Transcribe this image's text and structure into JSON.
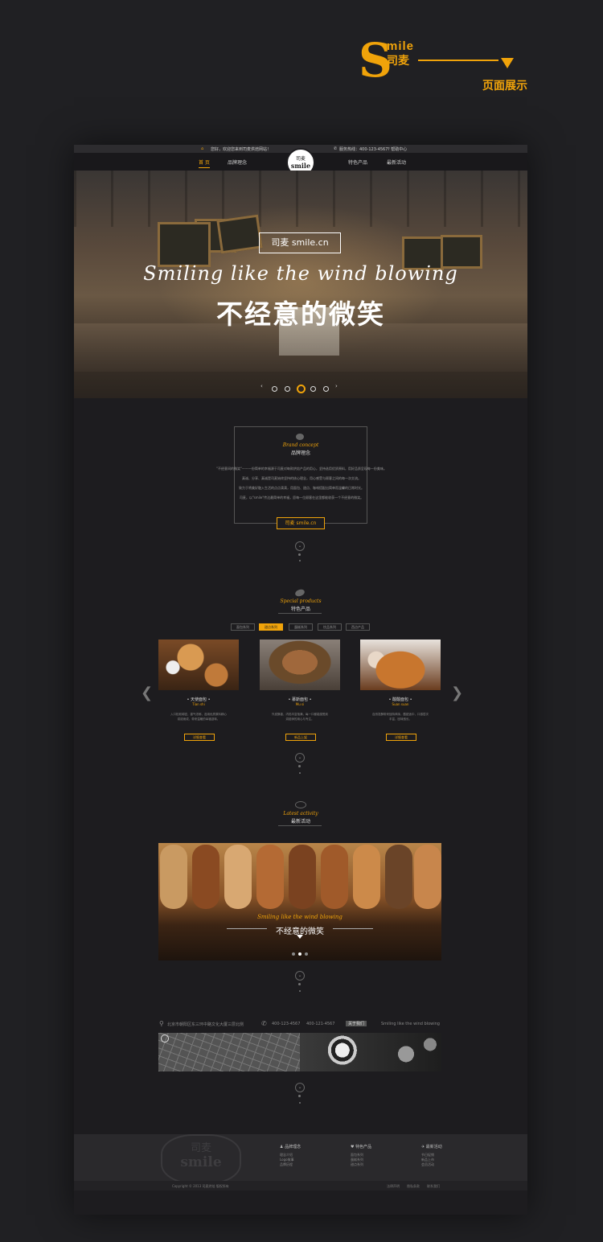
{
  "brand": {
    "s": "S",
    "mile": "mile",
    "cn": "司麦",
    "caption": "页面展示"
  },
  "topbar": {
    "welcome": "您好，欢迎您来到司麦烘焙网站！",
    "hotline": "服务热线：400-123-4567",
    "help": "帮助中心"
  },
  "nav": {
    "items": [
      "首 页",
      "品牌理念",
      "特色产品",
      "最新活动"
    ],
    "logo_cn": "司麦",
    "logo_en": "smile"
  },
  "hero": {
    "box_text": "司麦  smile.cn",
    "script": "Smiling like the wind blowing",
    "title": "不经意的微笑"
  },
  "concept": {
    "title_en": "Brand concept",
    "title_cn": "品牌理念",
    "paragraphs": [
      "\"不经意间的微笑\"——一份简单的幸福源于司麦对每款烘焙产品的用心，坚持选用优质原料，用好品质呈现每一份美味。",
      "真诚、分享、真诚是司麦始终坚持的核心理念，用心感受与顾客之间的每一次交流。",
      "致力于将美好融入生活的点点滴滴，用面包、甜点、咖啡搭配出简单而温馨的日常时光。",
      "司麦，以\"smile\"传达最简单的幸福，愿每一位顾客在这里都能收获一个不经意的微笑。"
    ],
    "button": "司麦  smile.cn"
  },
  "products": {
    "title_en": "Special products",
    "title_cn": "特色产品",
    "tabs": [
      "面包系列",
      "甜点系列",
      "蛋糕系列",
      "饮品系列",
      "西点产品"
    ],
    "items": [
      {
        "name": "• 天使面包 •",
        "en": "Tian shi",
        "desc": "入口松软绵密，香气浓郁，选用优质原料精心烘焙而成，带来温暖的幸福滋味。",
        "button": "详细查看"
      },
      {
        "name": "• 慕斯面包 •",
        "en": "Mu si",
        "desc": "外皮酥香，内馅丰富饱满，每一口都能感受到烘焙师的用心与专注。",
        "button": "新品上架"
      },
      {
        "name": "• 酸酸面包 •",
        "en": "Suan suan",
        "desc": "自然发酵带来独特风味，酸甜适中，口感层次丰富，回味悠长。",
        "button": "详细查看"
      }
    ]
  },
  "activity": {
    "title_en": "Latest activity",
    "title_cn": "最新活动",
    "script": "Smiling like the wind blowing",
    "title": "不经意的微笑"
  },
  "contact": {
    "address": "北京市朝阳区东三环中路文化大厦三层北侧",
    "phone1": "400-123-4567",
    "phone2": "400-121-4567",
    "badge": "关于我们",
    "slogan": "Smiling like the wind blowing"
  },
  "footer": {
    "logo_cn": "司麦",
    "logo_en": "smile",
    "cols": [
      {
        "head": "品牌理念",
        "links": [
          "理念介绍",
          "Logo故事",
          "品牌历程"
        ]
      },
      {
        "head": "特色产品",
        "links": [
          "面包系列",
          "蛋糕系列",
          "甜点系列"
        ]
      },
      {
        "head": "最新活动",
        "links": [
          "节日促销",
          "新品上市",
          "会员活动"
        ]
      }
    ],
    "copyright": "Copyright © 2013 司麦烘焙 版权所有",
    "bottom_links": [
      "法律声明",
      "隐私条款",
      "联系我们"
    ]
  },
  "colors": {
    "accent": "#f0a30a",
    "bg": "#202023",
    "frame": "#1d1c1f"
  }
}
